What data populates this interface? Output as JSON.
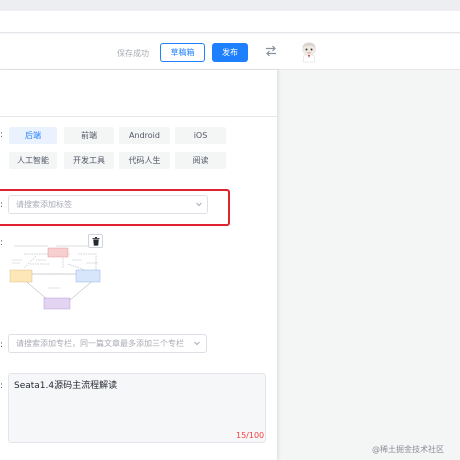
{
  "toolbar": {
    "saved_text": "保存成功",
    "draft_label": "草稿箱",
    "publish_label": "发布"
  },
  "form": {
    "category_colon": ":",
    "categories": [
      {
        "label": "后端",
        "active": true
      },
      {
        "label": "前端",
        "active": false
      },
      {
        "label": "Android",
        "active": false
      },
      {
        "label": "iOS",
        "active": false
      },
      {
        "label": "人工智能",
        "active": false
      },
      {
        "label": "开发工具",
        "active": false
      },
      {
        "label": "代码人生",
        "active": false
      },
      {
        "label": "阅读",
        "active": false
      }
    ],
    "tag_colon": ":",
    "tag_placeholder": "请搜索添加标签",
    "cover_colon": ":",
    "column_colon": ":",
    "column_placeholder": "请搜索添加专栏，同一篇文章最多添加三个专栏",
    "abstract_colon": ":",
    "abstract_text": "Seata1.4源码主流程解读",
    "abstract_count": "15/100"
  },
  "watermark": "@稀土掘金技术社区",
  "colors": {
    "brand": "#1e80ff",
    "highlight": "#e0242f",
    "count_red": "#f53f3f"
  }
}
